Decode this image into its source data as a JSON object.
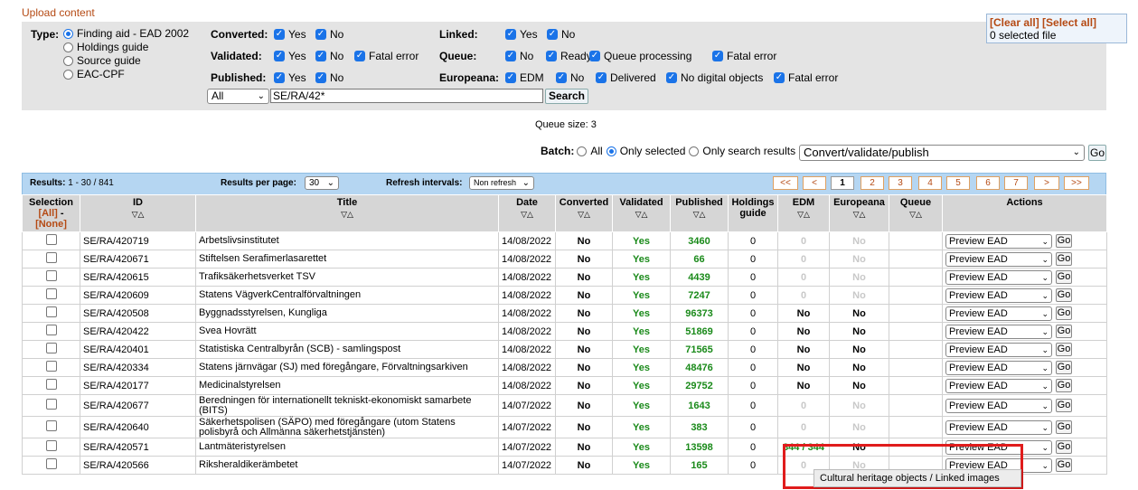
{
  "page": {
    "title": "Upload content"
  },
  "filters": {
    "type": {
      "label": "Type:",
      "options": [
        "Finding aid - EAD 2002",
        "Holdings guide",
        "Source guide",
        "EAC-CPF"
      ]
    },
    "converted": {
      "label": "Converted:",
      "options": [
        "Yes",
        "No"
      ]
    },
    "validated": {
      "label": "Validated:",
      "options": [
        "Yes",
        "No",
        "Fatal error"
      ]
    },
    "published": {
      "label": "Published:",
      "options": [
        "Yes",
        "No"
      ]
    },
    "linked": {
      "label": "Linked:",
      "options": [
        "Yes",
        "No"
      ]
    },
    "queue": {
      "label": "Queue:",
      "options": [
        "No",
        "Ready",
        "Queue processing",
        "Fatal error"
      ]
    },
    "europeana": {
      "label": "Europeana:",
      "options": [
        "EDM",
        "No",
        "Delivered",
        "No digital objects",
        "Fatal error"
      ]
    },
    "scope_select": "All",
    "search_value": "SE/RA/42*",
    "search_button": "Search"
  },
  "selection_box": {
    "clear_all": "[Clear all]",
    "select_all": "[Select all]",
    "count": "0 selected file"
  },
  "queue_size": "Queue size: 3",
  "batch": {
    "label": "Batch:",
    "options": [
      "All",
      "Only selected",
      "Only search results"
    ],
    "action": "Convert/validate/publish",
    "go": "Go"
  },
  "results_bar": {
    "results_label": "Results:",
    "results_value": "1 - 30 / 841",
    "per_page_label": "Results per page:",
    "per_page_value": "30",
    "refresh_label": "Refresh intervals:",
    "refresh_value": "Non refresh",
    "pagination": [
      "<<",
      "<",
      "1",
      "2",
      "3",
      "4",
      "5",
      "6",
      "7",
      ">",
      ">>"
    ]
  },
  "table": {
    "headers": {
      "selection": "Selection",
      "sel_all": "[All]",
      "sel_dash": " - ",
      "sel_none": "[None]",
      "id": "ID",
      "title": "Title",
      "date": "Date",
      "converted": "Converted",
      "validated": "Validated",
      "published": "Published",
      "holdings": "Holdings guide",
      "edm": "EDM",
      "europeana": "Europeana",
      "queue": "Queue",
      "actions": "Actions"
    },
    "sort_glyph": "▽△",
    "rows": [
      {
        "id": "SE/RA/420719",
        "title": "Arbetslivsinstitutet",
        "date": "14/08/2022",
        "converted": "No",
        "validated": "Yes",
        "published": "3460",
        "holdings": "0",
        "edm": "0",
        "europeana": "No",
        "action": "Preview EAD",
        "go": "Go"
      },
      {
        "id": "SE/RA/420671",
        "title": "Stiftelsen Serafimerlasarettet",
        "date": "14/08/2022",
        "converted": "No",
        "validated": "Yes",
        "published": "66",
        "holdings": "0",
        "edm": "0",
        "europeana": "No",
        "action": "Preview EAD",
        "go": "Go"
      },
      {
        "id": "SE/RA/420615",
        "title": "Trafiksäkerhetsverket TSV",
        "date": "14/08/2022",
        "converted": "No",
        "validated": "Yes",
        "published": "4439",
        "holdings": "0",
        "edm": "0",
        "europeana": "No",
        "action": "Preview EAD",
        "go": "Go"
      },
      {
        "id": "SE/RA/420609",
        "title": "Statens VägverkCentralförvaltningen",
        "date": "14/08/2022",
        "converted": "No",
        "validated": "Yes",
        "published": "7247",
        "holdings": "0",
        "edm": "0",
        "europeana": "No",
        "action": "Preview EAD",
        "go": "Go"
      },
      {
        "id": "SE/RA/420508",
        "title": "Byggnadsstyrelsen, Kungliga",
        "date": "14/08/2022",
        "converted": "No",
        "validated": "Yes",
        "published": "96373",
        "holdings": "0",
        "edm": "No",
        "europeana": "No",
        "action": "Preview EAD",
        "go": "Go"
      },
      {
        "id": "SE/RA/420422",
        "title": "Svea Hovrätt",
        "date": "14/08/2022",
        "converted": "No",
        "validated": "Yes",
        "published": "51869",
        "holdings": "0",
        "edm": "No",
        "europeana": "No",
        "action": "Preview EAD",
        "go": "Go"
      },
      {
        "id": "SE/RA/420401",
        "title": "Statistiska Centralbyrån (SCB) - samlingspost",
        "date": "14/08/2022",
        "converted": "No",
        "validated": "Yes",
        "published": "71565",
        "holdings": "0",
        "edm": "No",
        "europeana": "No",
        "action": "Preview EAD",
        "go": "Go"
      },
      {
        "id": "SE/RA/420334",
        "title": "Statens järnvägar (SJ) med föregångare, Förvaltningsarkiven",
        "date": "14/08/2022",
        "converted": "No",
        "validated": "Yes",
        "published": "48476",
        "holdings": "0",
        "edm": "No",
        "europeana": "No",
        "action": "Preview EAD",
        "go": "Go"
      },
      {
        "id": "SE/RA/420177",
        "title": "Medicinalstyrelsen",
        "date": "14/08/2022",
        "converted": "No",
        "validated": "Yes",
        "published": "29752",
        "holdings": "0",
        "edm": "No",
        "europeana": "No",
        "action": "Preview EAD",
        "go": "Go"
      },
      {
        "id": "SE/RA/420677",
        "title": "Beredningen för internationellt tekniskt-ekonomiskt samarbete (BITS)",
        "date": "14/07/2022",
        "converted": "No",
        "validated": "Yes",
        "published": "1643",
        "holdings": "0",
        "edm": "0",
        "europeana": "No",
        "action": "Preview EAD",
        "go": "Go"
      },
      {
        "id": "SE/RA/420640",
        "title": "Säkerhetspolisen (SÄPO) med föregångare (utom Statens polisbyrå och Allmänna säkerhetstjänsten)",
        "date": "14/07/2022",
        "converted": "No",
        "validated": "Yes",
        "published": "383",
        "holdings": "0",
        "edm": "0",
        "europeana": "No",
        "action": "Preview EAD",
        "go": "Go"
      },
      {
        "id": "SE/RA/420571",
        "title": "Lantmäteristyrelsen",
        "date": "14/07/2022",
        "converted": "No",
        "validated": "Yes",
        "published": "13598",
        "holdings": "0",
        "edm": "344 / 344",
        "europeana": "No",
        "action": "Preview EAD",
        "go": "Go"
      },
      {
        "id": "SE/RA/420566",
        "title": "Riksheraldikerämbetet",
        "date": "14/07/2022",
        "converted": "No",
        "validated": "Yes",
        "published": "165",
        "holdings": "0",
        "edm": "0",
        "europeana": "No",
        "action": "Preview EAD",
        "go": "Go"
      }
    ]
  },
  "tooltip": "Cultural heritage objects / Linked images",
  "colors": {
    "accent": "#b54a14",
    "yes": "#1a8a1a",
    "highlight": "#e01c1c",
    "bar": "#b5d6f2"
  }
}
